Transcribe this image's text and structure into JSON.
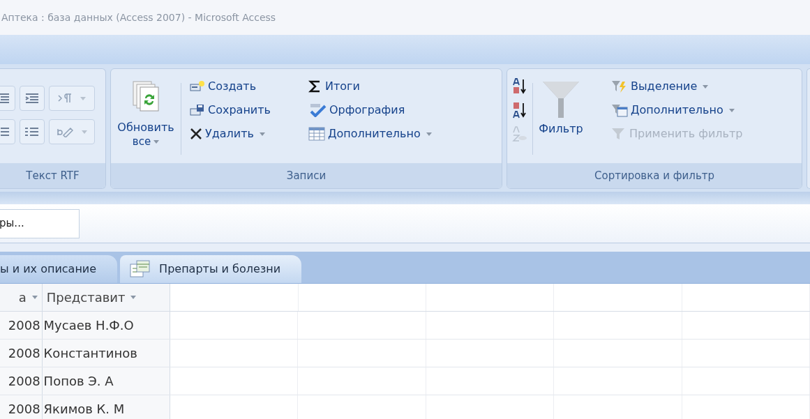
{
  "window": {
    "title": "Аптека : база данных (Access 2007) - Microsoft Access"
  },
  "ribbon": {
    "groups": [
      {
        "kind": "rtf",
        "label": "Текст RTF"
      },
      {
        "kind": "records",
        "label": "Записи",
        "big_button": {
          "label": "Обновить",
          "label_2": "все",
          "dropdown": true
        },
        "items": [
          {
            "label": "Создать",
            "dropdown": false,
            "disabled": false
          },
          {
            "label": "Сохранить",
            "dropdown": false,
            "disabled": false
          },
          {
            "label": "Удалить",
            "dropdown": true,
            "disabled": false
          },
          {
            "label": "Итоги",
            "dropdown": false,
            "disabled": false
          },
          {
            "label": "Орфография",
            "dropdown": false,
            "disabled": false
          },
          {
            "label": "Дополнительно",
            "dropdown": true,
            "disabled": false
          }
        ]
      },
      {
        "kind": "sort",
        "label": "Сортировка и фильтр",
        "big_button": {
          "label": "Фильтр"
        },
        "items": [
          {
            "label": "Выделение",
            "dropdown": true,
            "disabled": false
          },
          {
            "label": "Дополнительно",
            "dropdown": true,
            "disabled": false
          },
          {
            "label": "Применить фильтр",
            "dropdown": false,
            "disabled": true
          }
        ]
      }
    ]
  },
  "search": {
    "value": "ры..."
  },
  "doc_tabs": [
    {
      "label": "ы и их описание",
      "selected": false,
      "icon": false
    },
    {
      "label": "Препарты и болезни",
      "selected": true,
      "icon": true
    }
  ],
  "table": {
    "columns": [
      {
        "label": "а"
      },
      {
        "label": "Представит"
      }
    ],
    "rows": [
      [
        "2008",
        "Мусаев Н.Ф.О"
      ],
      [
        "2008",
        "Константинов"
      ],
      [
        "2008",
        "Попов Э. А"
      ],
      [
        "2008",
        "Якимов К. М"
      ]
    ]
  }
}
